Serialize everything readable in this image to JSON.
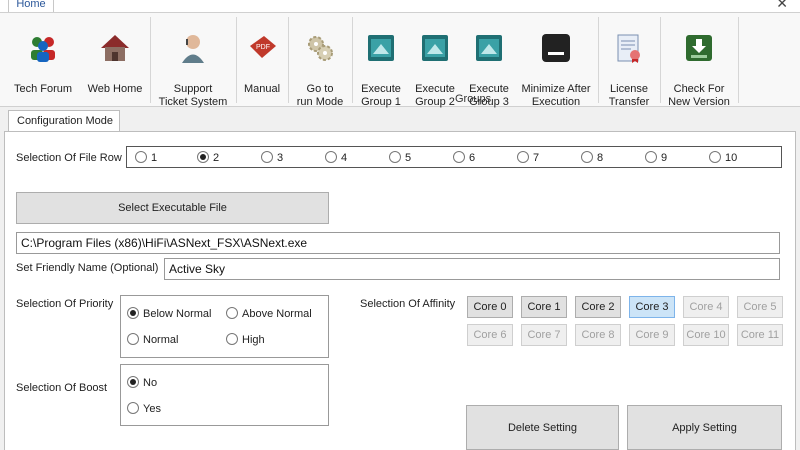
{
  "ribbon": {
    "tab_home": "Home",
    "close": "✕",
    "buttons": [
      {
        "id": "tech-forum",
        "label": "Tech Forum",
        "icon": "people-icon"
      },
      {
        "id": "web-home",
        "label": "Web Home",
        "icon": "house-icon"
      },
      {
        "id": "support",
        "label": "Support\nTicket System",
        "icon": "support-person-icon"
      },
      {
        "id": "manual",
        "label": "Manual",
        "icon": "pdf-icon"
      },
      {
        "id": "run-mode",
        "label": "Go to\nrun Mode",
        "icon": "gears-icon"
      },
      {
        "id": "group1",
        "label": "Execute\nGroup 1",
        "icon": "group-window-icon"
      },
      {
        "id": "group2",
        "label": "Execute\nGroup 2",
        "icon": "group-window-icon"
      },
      {
        "id": "group3",
        "label": "Execute\nGroup 3",
        "icon": "group-window-icon"
      },
      {
        "id": "minimize",
        "label": "Minimize After\nExecution",
        "icon": "minimize-icon"
      },
      {
        "id": "license",
        "label": "License\nTransfer",
        "icon": "certificate-icon"
      },
      {
        "id": "check-version",
        "label": "Check For\nNew Version",
        "icon": "download-icon"
      }
    ],
    "groups_label": "Groups"
  },
  "config": {
    "tab_label": "Configuration Mode",
    "file_row_label": "Selection Of File Row",
    "file_rows": [
      "1",
      "2",
      "3",
      "4",
      "5",
      "6",
      "7",
      "8",
      "9",
      "10"
    ],
    "file_row_selected": "2",
    "select_exe_label": "Select Executable File",
    "exe_path": "C:\\Program Files (x86)\\HiFi\\ASNext_FSX\\ASNext.exe",
    "friendly_label": "Set Friendly Name (Optional)",
    "friendly_value": "Active Sky",
    "priority_label": "Selection Of Priority",
    "priority": {
      "below_normal": "Below Normal",
      "above_normal": "Above Normal",
      "normal": "Normal",
      "high": "High",
      "selected": "Below Normal"
    },
    "boost_label": "Selection Of Boost",
    "boost": {
      "no": "No",
      "yes": "Yes",
      "selected": "No"
    },
    "affinity_label": "Selection Of Affinity",
    "cores": [
      "Core 0",
      "Core 1",
      "Core 2",
      "Core 3",
      "Core 4",
      "Core 5",
      "Core 6",
      "Core 7",
      "Core 8",
      "Core 9",
      "Core 10",
      "Core 11"
    ],
    "core_selected": "Core 3",
    "cores_enabled": [
      "Core 0",
      "Core 1",
      "Core 2",
      "Core 3"
    ],
    "delete_label": "Delete Setting",
    "apply_label": "Apply Setting"
  },
  "colors": {
    "accent": "#2b579a",
    "core_selected_bg": "#cce4f7"
  }
}
